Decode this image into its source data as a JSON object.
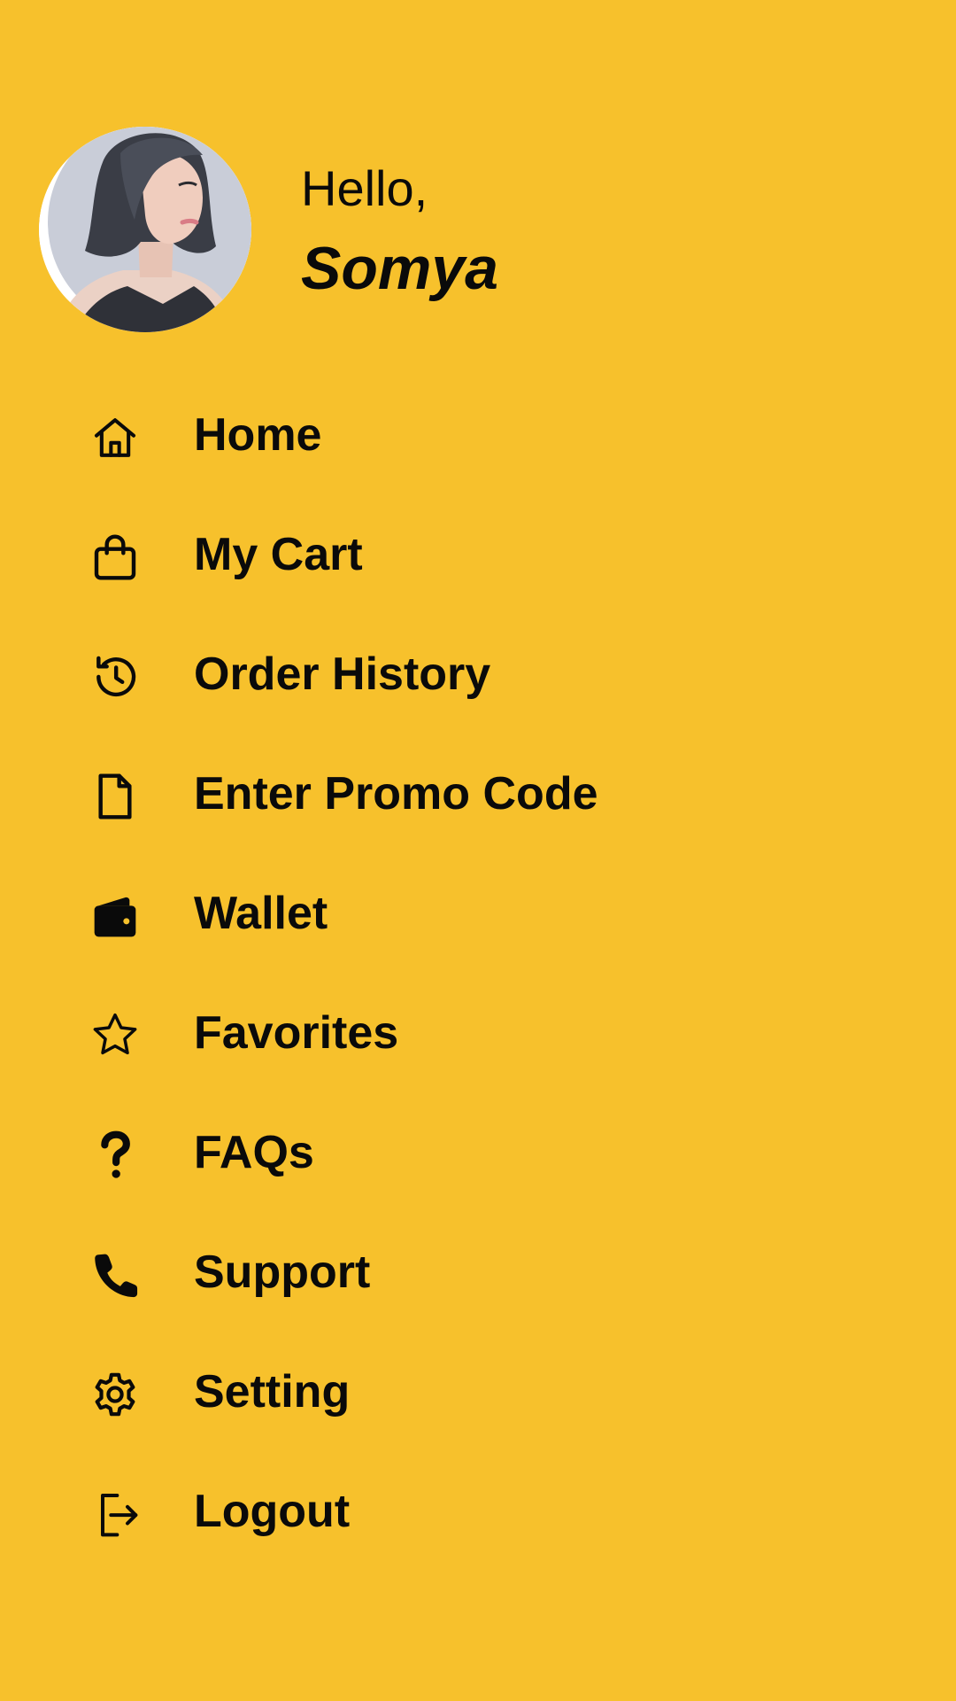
{
  "colors": {
    "background": "#F7C12C",
    "text": "#0A0A0A"
  },
  "profile": {
    "greeting": "Hello,",
    "name": "Somya",
    "avatar_icon": "user-avatar-photo"
  },
  "menu": {
    "items": [
      {
        "label": "Home",
        "icon": "home-icon"
      },
      {
        "label": "My Cart",
        "icon": "shopping-bag-icon"
      },
      {
        "label": "Order History",
        "icon": "history-icon"
      },
      {
        "label": "Enter Promo Code",
        "icon": "document-icon"
      },
      {
        "label": "Wallet",
        "icon": "wallet-icon"
      },
      {
        "label": "Favorites",
        "icon": "star-icon"
      },
      {
        "label": "FAQs",
        "icon": "question-mark-icon"
      },
      {
        "label": "Support",
        "icon": "phone-icon"
      },
      {
        "label": "Setting",
        "icon": "gear-icon"
      },
      {
        "label": "Logout",
        "icon": "logout-icon"
      }
    ]
  }
}
